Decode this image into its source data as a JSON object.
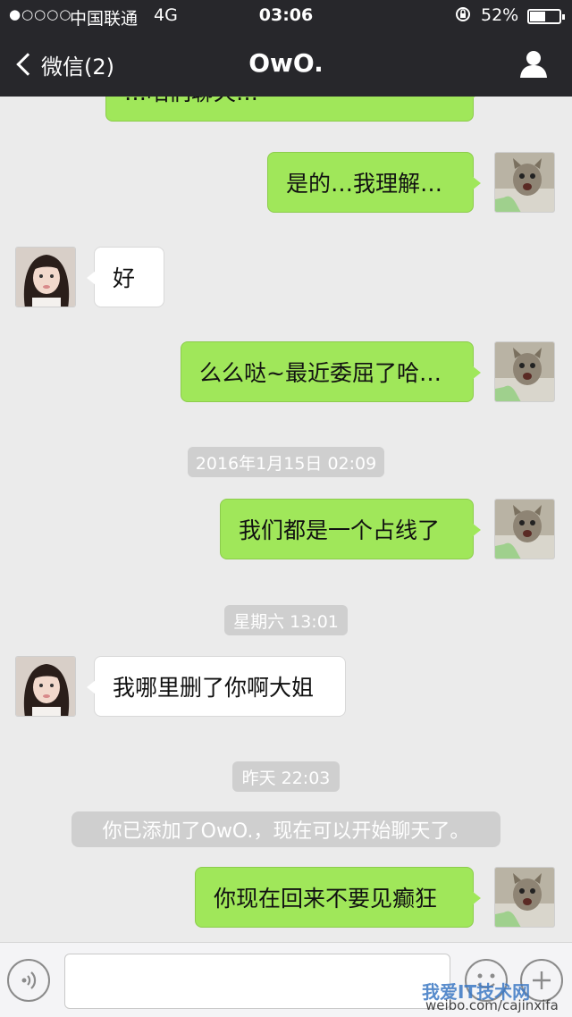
{
  "status_bar": {
    "signal": "●○○○○",
    "carrier": "中国联通",
    "network": "4G",
    "time": "03:06",
    "battery_percent": "52%",
    "battery_level": 0.52
  },
  "nav": {
    "back_label": "微信(2)",
    "title": "OwO."
  },
  "messages": [
    {
      "type": "message",
      "side": "me",
      "text": "…咱们聊天…"
    },
    {
      "type": "message",
      "side": "me",
      "text": "是的…我理解…"
    },
    {
      "type": "message",
      "side": "them",
      "text": "好"
    },
    {
      "type": "message",
      "side": "me",
      "text": "么么哒~最近委屈了哈…"
    },
    {
      "type": "timestamp",
      "text": "2016年1月15日 02:09"
    },
    {
      "type": "message",
      "side": "me",
      "text": "我们都是一个占线了"
    },
    {
      "type": "timestamp",
      "text": "星期六 13:01"
    },
    {
      "type": "message",
      "side": "them",
      "text": "我哪里删了你啊大姐"
    },
    {
      "type": "timestamp",
      "text": "昨天 22:03"
    },
    {
      "type": "system",
      "text": "你已添加了OwO.，现在可以开始聊天了。"
    },
    {
      "type": "message",
      "side": "me",
      "text": "你现在回来不要见癫狂"
    }
  ],
  "input_bar": {
    "voice_icon": "voice-icon",
    "emoji_icon": "emoji-icon",
    "plus_icon": "plus-icon"
  },
  "watermark": {
    "logo_text": "我爱IT技术网",
    "url": "weibo.com/cajinxifa"
  },
  "colors": {
    "header_bg": "#27272b",
    "bubble_me": "#a0e75a",
    "bubble_them": "#ffffff",
    "chat_bg": "#ebebeb"
  }
}
